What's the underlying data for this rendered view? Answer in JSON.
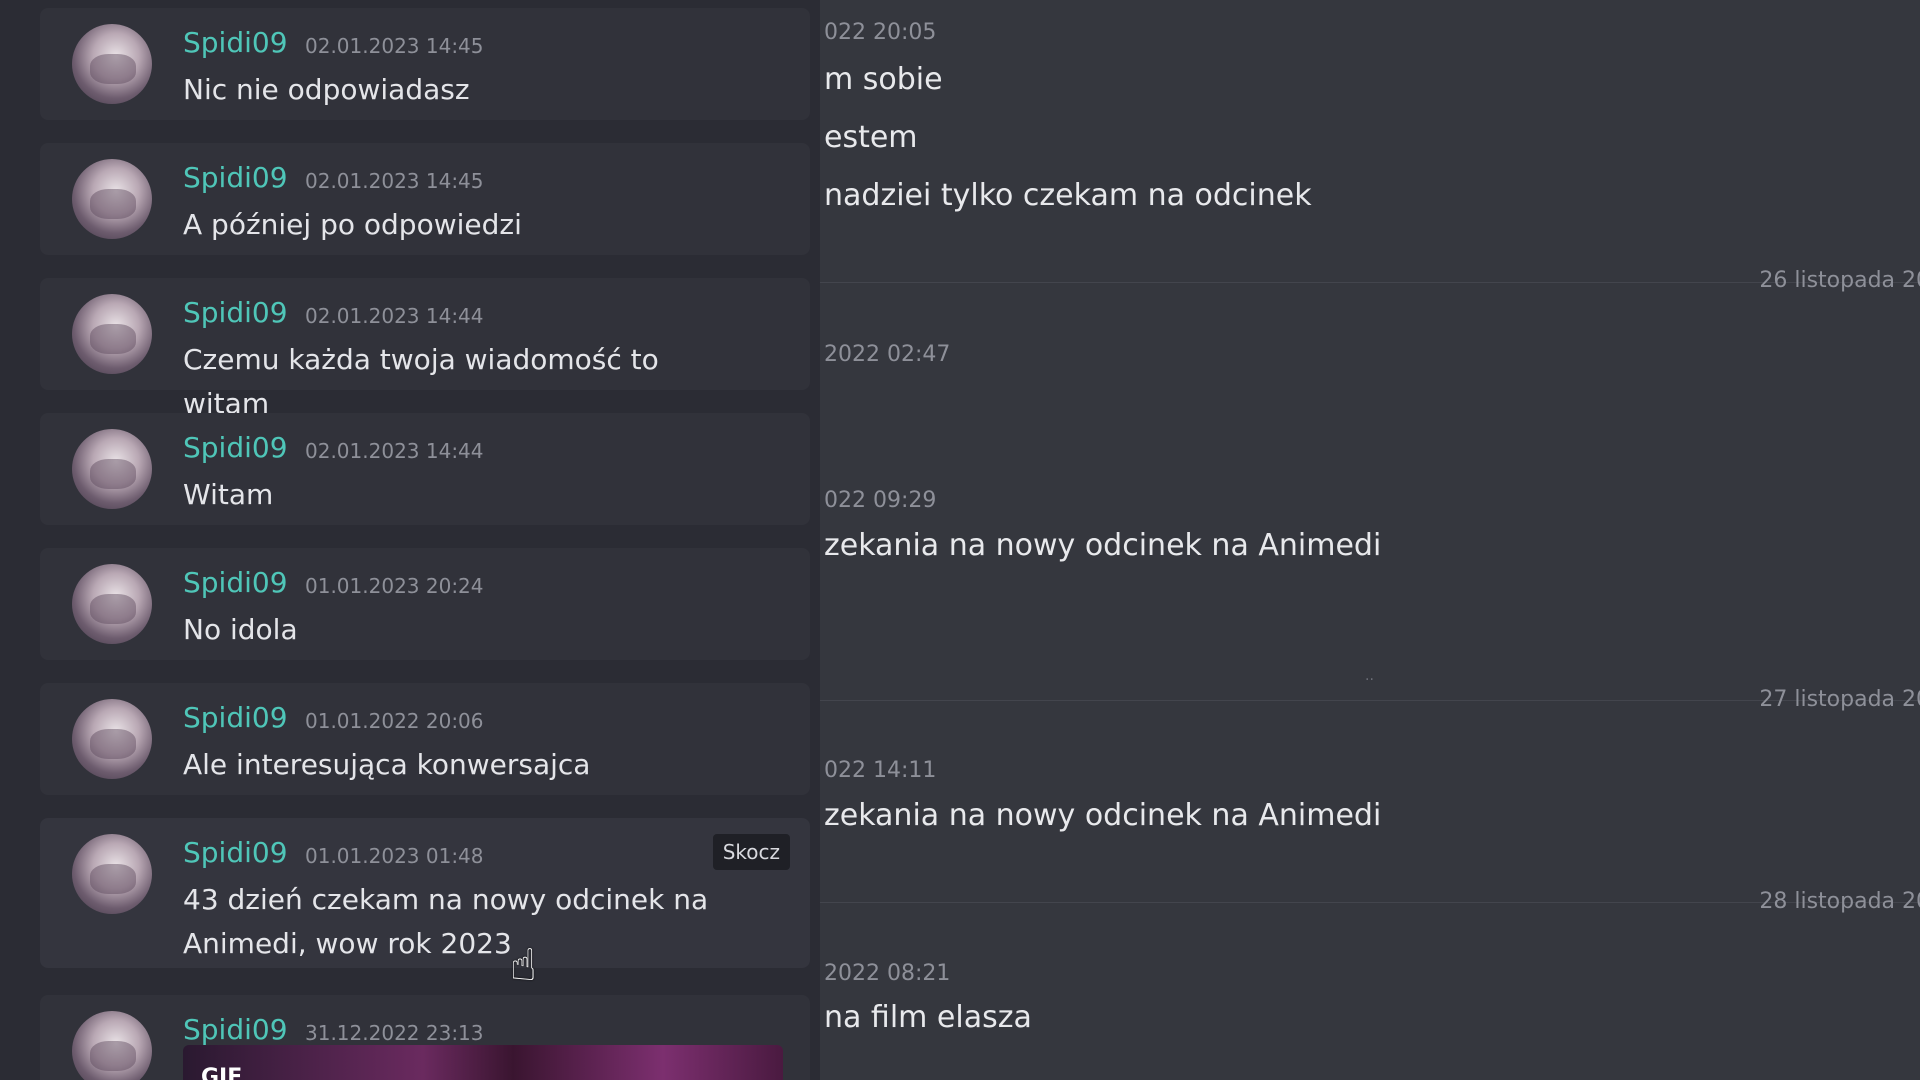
{
  "results": [
    {
      "author": "Spidi09",
      "time": "02.01.2023 14:45",
      "text": "Nic nie odpowiadasz"
    },
    {
      "author": "Spidi09",
      "time": "02.01.2023 14:45",
      "text": "A później po odpowiedzi"
    },
    {
      "author": "Spidi09",
      "time": "02.01.2023 14:44",
      "text": "Czemu każda twoja wiadomość to witam"
    },
    {
      "author": "Spidi09",
      "time": "02.01.2023 14:44",
      "text": "Witam"
    },
    {
      "author": "Spidi09",
      "time": "01.01.2023 20:24",
      "text": "No idola"
    },
    {
      "author": "Spidi09",
      "time": "01.01.2022 20:06",
      "text": "Ale interesująca konwersajca"
    },
    {
      "author": "Spidi09",
      "time": "01.01.2023 01:48",
      "text": "43 dzień czekam na nowy odcinek na Animedi, wow rok 2023",
      "jump_label": "Skocz"
    },
    {
      "author": "Spidi09",
      "time": "31.12.2022 23:13",
      "gif_label": "GIF"
    }
  ],
  "chat": {
    "m1_meta": "022 20:05",
    "m1_line1": "m sobie",
    "m1_line2": "estem",
    "m1_line3": "nadziei tylko czekam na odcinek",
    "div1": "26 listopada 20",
    "m2_meta": "2022 02:47",
    "m3_meta": "022 09:29",
    "m3_text": "zekania na nowy odcinek na Animedi",
    "div2": "27 listopada 20",
    "m4_meta": "022 14:11",
    "m4_text": "zekania na nowy odcinek na Animedi",
    "div3": "28 listopada 20",
    "m5_meta": "2022 08:21",
    "m5_text": "na film elasza"
  },
  "colors": {
    "author": "#4fc6b8",
    "panel": "#2b2c34",
    "chat_bg": "#35373e"
  },
  "icons": {
    "cursor": "hand-pointer-icon"
  }
}
